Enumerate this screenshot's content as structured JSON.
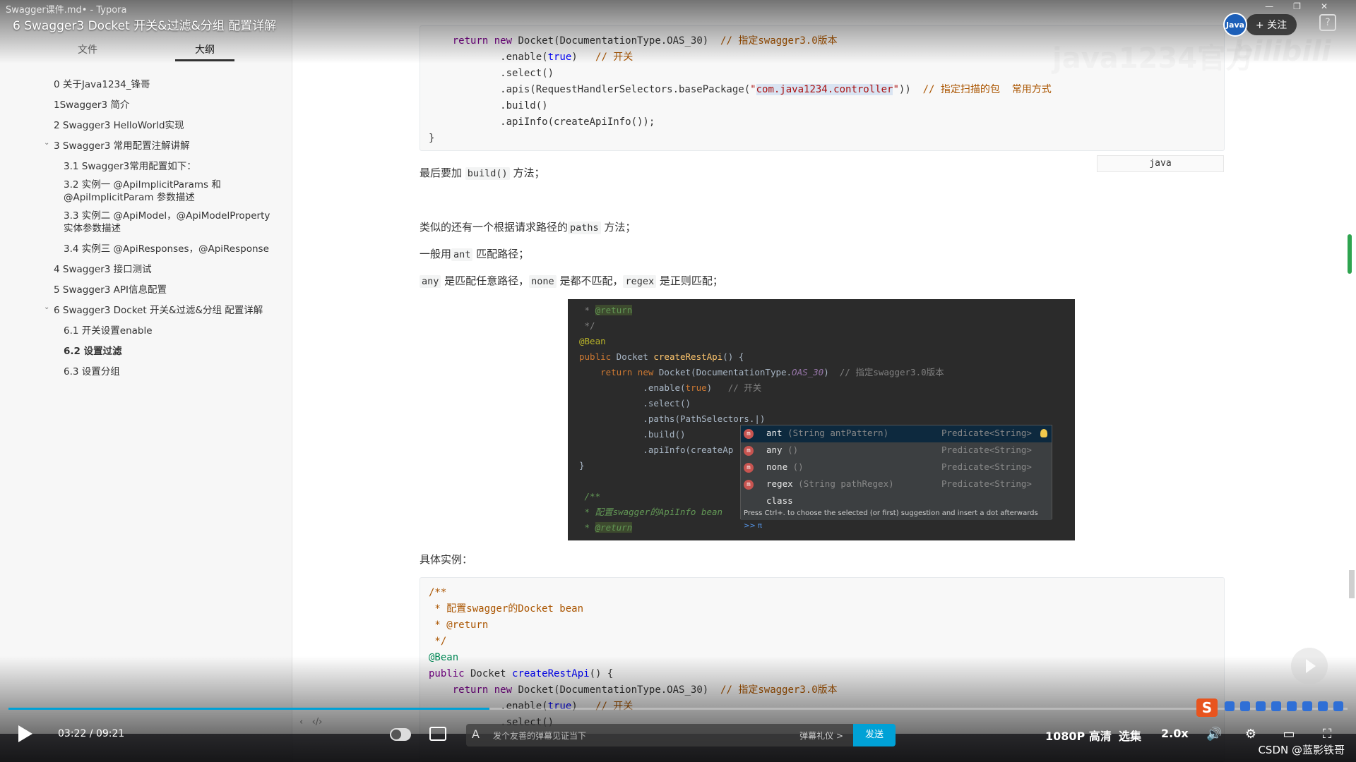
{
  "window": {
    "title": "Swagger课件.md• - Typora"
  },
  "video": {
    "title": "6 Swagger3 Docket 开关&过滤&分组 配置详解",
    "watermark": "java1234官方",
    "watermark_logo": "bilibili",
    "follow_label": "+ 关注",
    "help": "?"
  },
  "sidebar": {
    "tabs": [
      "文件",
      "大纲"
    ],
    "active_tab": "大纲",
    "outline": [
      {
        "label": "0 关于Java1234_锋哥",
        "level": 1
      },
      {
        "label": "1Swagger3 简介",
        "level": 1
      },
      {
        "label": "2 Swagger3 HelloWorld实现",
        "level": 1
      },
      {
        "label": "3 Swagger3 常用配置注解讲解",
        "level": 1,
        "expanded": true
      },
      {
        "label": "3.1 Swagger3常用配置如下：",
        "level": 2
      },
      {
        "label": "3.2 实例一 @ApiImplicitParams 和 @ApiImplicitParam 参数描述",
        "level": 2
      },
      {
        "label": "3.3 实例二 @ApiModel，@ApiModelProperty 实体参数描述",
        "level": 2
      },
      {
        "label": "3.4 实例三 @ApiResponses，@ApiResponse",
        "level": 2
      },
      {
        "label": "4 Swagger3 接口测试",
        "level": 1
      },
      {
        "label": "5 Swagger3 API信息配置",
        "level": 1
      },
      {
        "label": "6 Swagger3 Docket 开关&过滤&分组 配置详解",
        "level": 1,
        "expanded": true
      },
      {
        "label": "6.1 开关设置enable",
        "level": 2
      },
      {
        "label": "6.2 设置过滤",
        "level": 2,
        "active": true
      },
      {
        "label": "6.3 设置分组",
        "level": 2
      }
    ]
  },
  "doc": {
    "code1_lang": "java",
    "p_build_prefix": "最后要加 ",
    "p_build_code": "build()",
    "p_build_suffix": " 方法；",
    "p_paths_prefix": "类似的还有一个根据请求路径的",
    "p_paths_code": "paths",
    "p_paths_suffix": " 方法；",
    "p_ant_prefix": "一般用",
    "p_ant_code": "ant",
    "p_ant_suffix": " 匹配路径；",
    "p_any_code": "any",
    "p_any_text": " 是匹配任意路径，",
    "p_none_code": "none",
    "p_none_text": " 是都不匹配，",
    "p_regex_code": "regex",
    "p_regex_text": " 是正则匹配；",
    "p_example": "具体实例："
  },
  "ide": {
    "suggestions": [
      {
        "name": "ant",
        "args": "(String antPattern)",
        "type": "Predicate<String>"
      },
      {
        "name": "any",
        "args": "()",
        "type": "Predicate<String>"
      },
      {
        "name": "none",
        "args": "()",
        "type": "Predicate<String>"
      },
      {
        "name": "regex",
        "args": "(String pathRegex)",
        "type": "Predicate<String>"
      },
      {
        "name": "class",
        "args": "",
        "type": ""
      }
    ],
    "hint": "Press Ctrl+. to choose the selected (or first) suggestion and insert a dot afterwards",
    "hint_link": ">> π"
  },
  "player": {
    "current_time": "03:22",
    "separator": " / ",
    "duration": "09:21",
    "progress": 0.359,
    "danmaku_placeholder": "发个友善的弹幕见证当下",
    "danmaku_etiquette": "弹幕礼仪 >",
    "send_label": "发送",
    "quality": "1080P 高清",
    "episodes": "选集",
    "speed": "2.0x"
  },
  "credit": "CSDN @蓝影铁哥",
  "colors": {
    "accent": "#00a1d6",
    "csdn": "#e8541e"
  }
}
